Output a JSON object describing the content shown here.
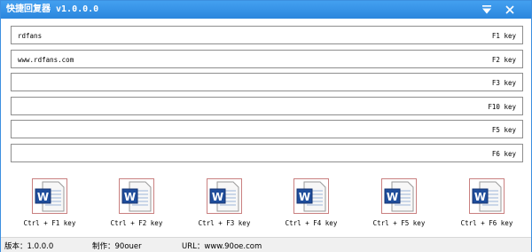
{
  "window": {
    "title": "快捷回复器 v1.0.0.0",
    "accent": "#2b86dd",
    "menu_icon": "triangle-down-icon",
    "close_icon": "close-icon"
  },
  "fields": [
    {
      "value": "rdfans",
      "key": "F1 key"
    },
    {
      "value": "www.rdfans.com",
      "key": "F2 key"
    },
    {
      "value": "",
      "key": "F3 key"
    },
    {
      "value": "",
      "key": "F10 key"
    },
    {
      "value": "",
      "key": "F5 key"
    },
    {
      "value": "",
      "key": "F6 key"
    }
  ],
  "shortcuts": [
    {
      "label": "Ctrl + F1 key",
      "icon": "word-document-icon"
    },
    {
      "label": "Ctrl + F2 key",
      "icon": "word-document-icon"
    },
    {
      "label": "Ctrl + F3 key",
      "icon": "word-document-icon"
    },
    {
      "label": "Ctrl + F4 key",
      "icon": "word-document-icon"
    },
    {
      "label": "Ctrl + F5 key",
      "icon": "word-document-icon"
    },
    {
      "label": "Ctrl + F6 key",
      "icon": "word-document-icon"
    }
  ],
  "status": {
    "version": "版本：1.0.0.0",
    "author": "制作：90ouer",
    "url": "URL：www.90oe.com"
  }
}
